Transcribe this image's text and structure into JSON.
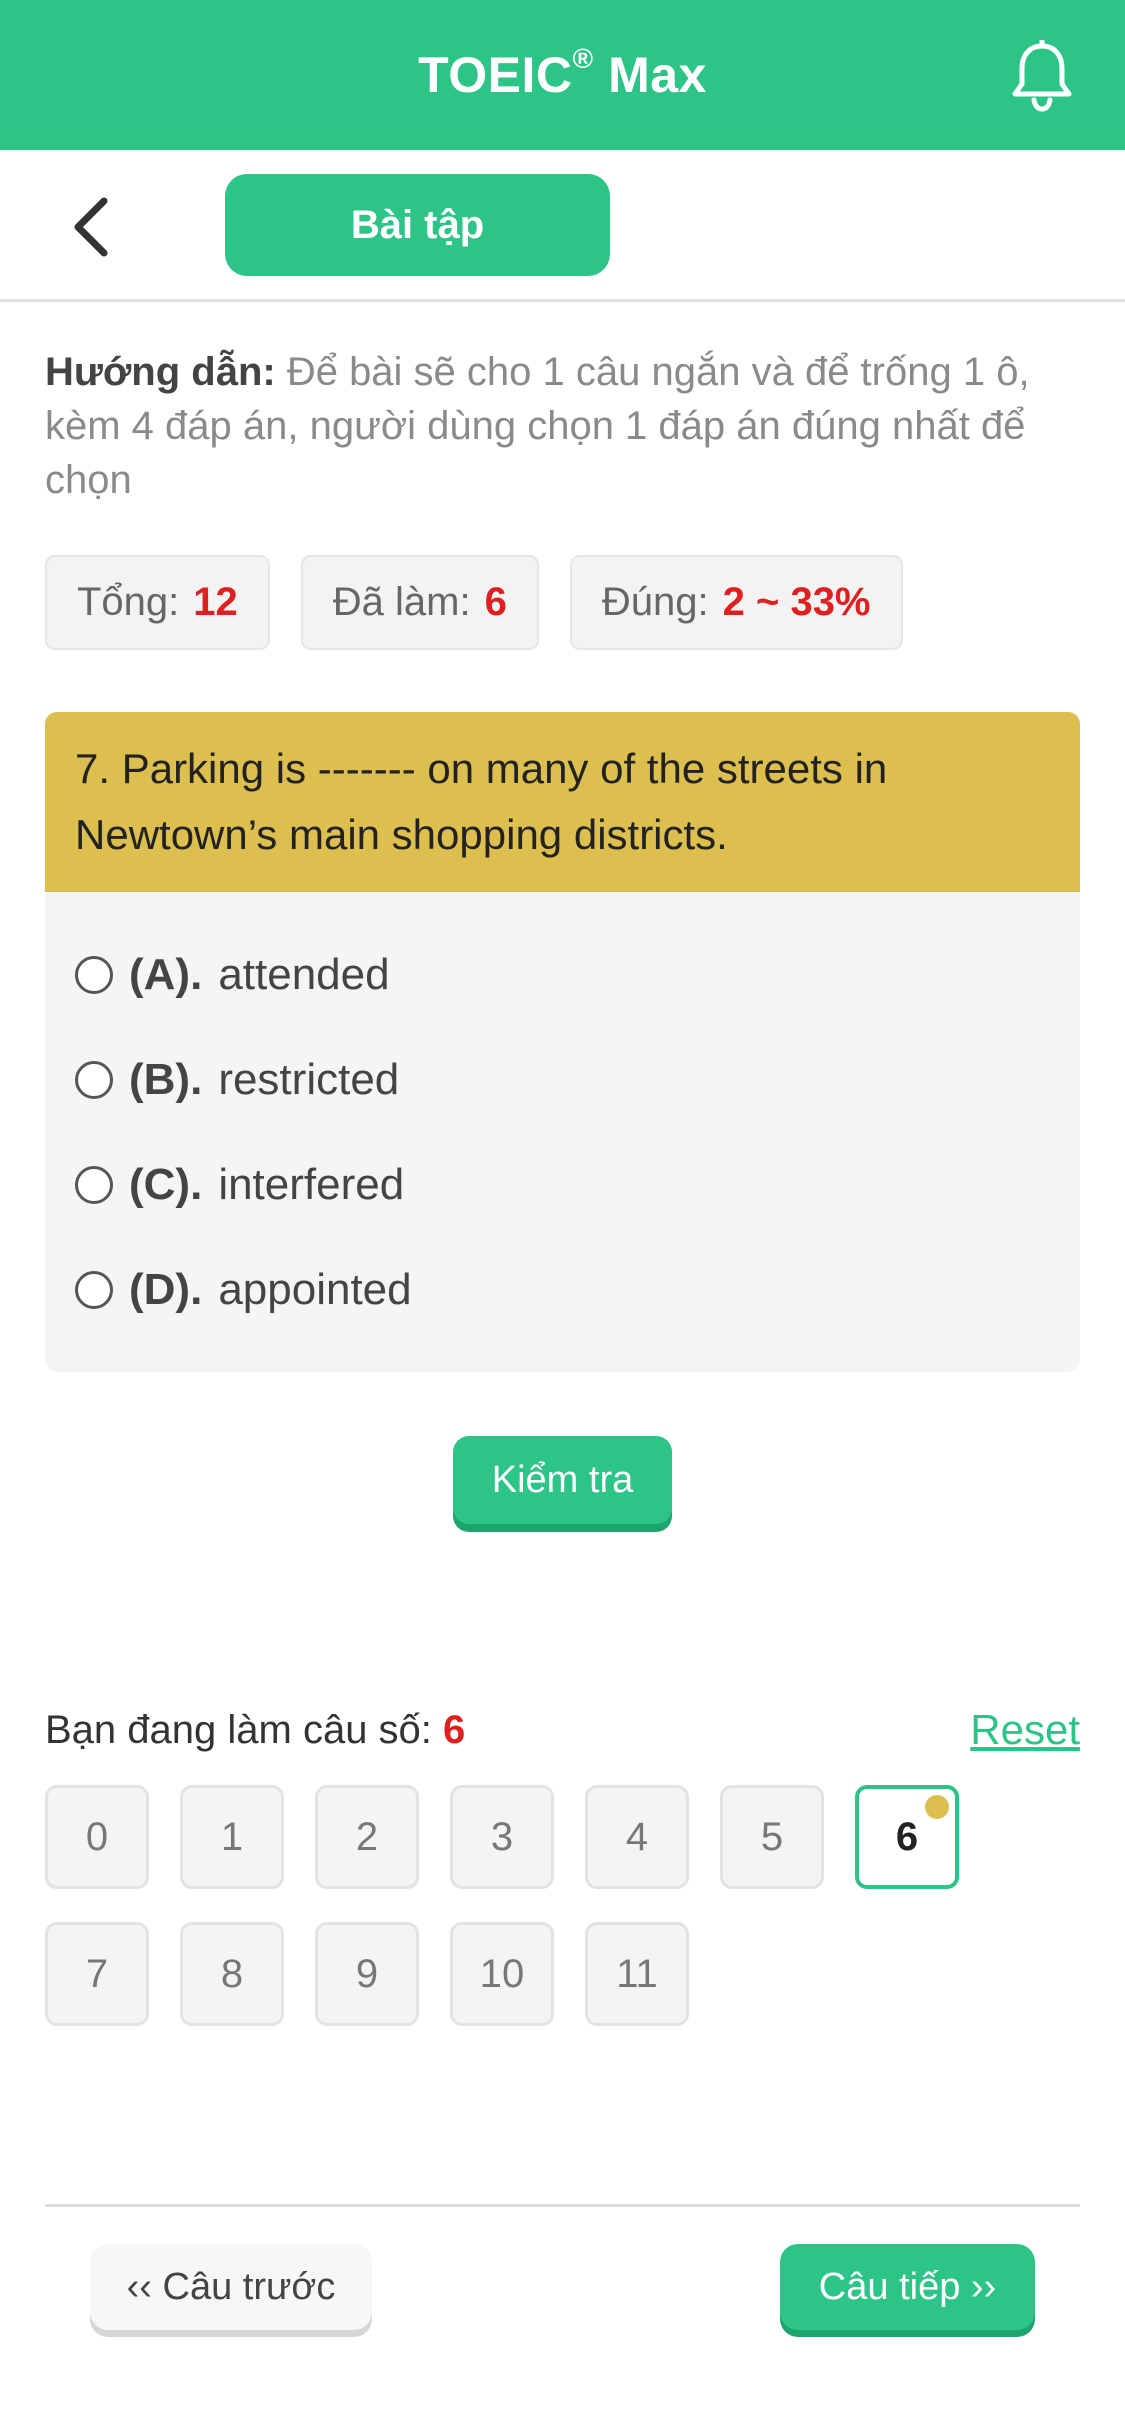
{
  "appbar": {
    "title_main": "TOEIC",
    "title_reg": "®",
    "title_suffix": " Max"
  },
  "header": {
    "tab_label": "Bài tập"
  },
  "instructions": {
    "label": "Hướng dẫn:",
    "text": " Để bài sẽ cho 1 câu ngắn và để trống 1 ô, kèm 4 đáp án, người dùng chọn 1 đáp án đúng nhất để chọn"
  },
  "stats": {
    "total_label": "Tổng:",
    "total_value": "12",
    "done_label": "Đã làm:",
    "done_value": "6",
    "correct_label": "Đúng:",
    "correct_value": "2 ~ 33%"
  },
  "question": {
    "text": "7. Parking is ------- on many of the streets in Newtown’s main shopping districts.",
    "options": [
      {
        "key": "(A).",
        "text": "attended"
      },
      {
        "key": "(B).",
        "text": "restricted"
      },
      {
        "key": "(C).",
        "text": "interfered"
      },
      {
        "key": "(D).",
        "text": "appointed"
      }
    ],
    "check_label": "Kiểm tra"
  },
  "progress": {
    "label": "Bạn đang làm câu số:",
    "current": "6",
    "reset_label": "Reset",
    "cells": [
      "0",
      "1",
      "2",
      "3",
      "4",
      "5",
      "6",
      "7",
      "8",
      "9",
      "10",
      "11"
    ]
  },
  "nav": {
    "prev_label": "‹‹ Câu trước",
    "next_label": "Câu tiếp ››"
  },
  "colors": {
    "primary": "#2dc487",
    "question_header": "#dcbf4e",
    "accent_red": "#e02020"
  }
}
